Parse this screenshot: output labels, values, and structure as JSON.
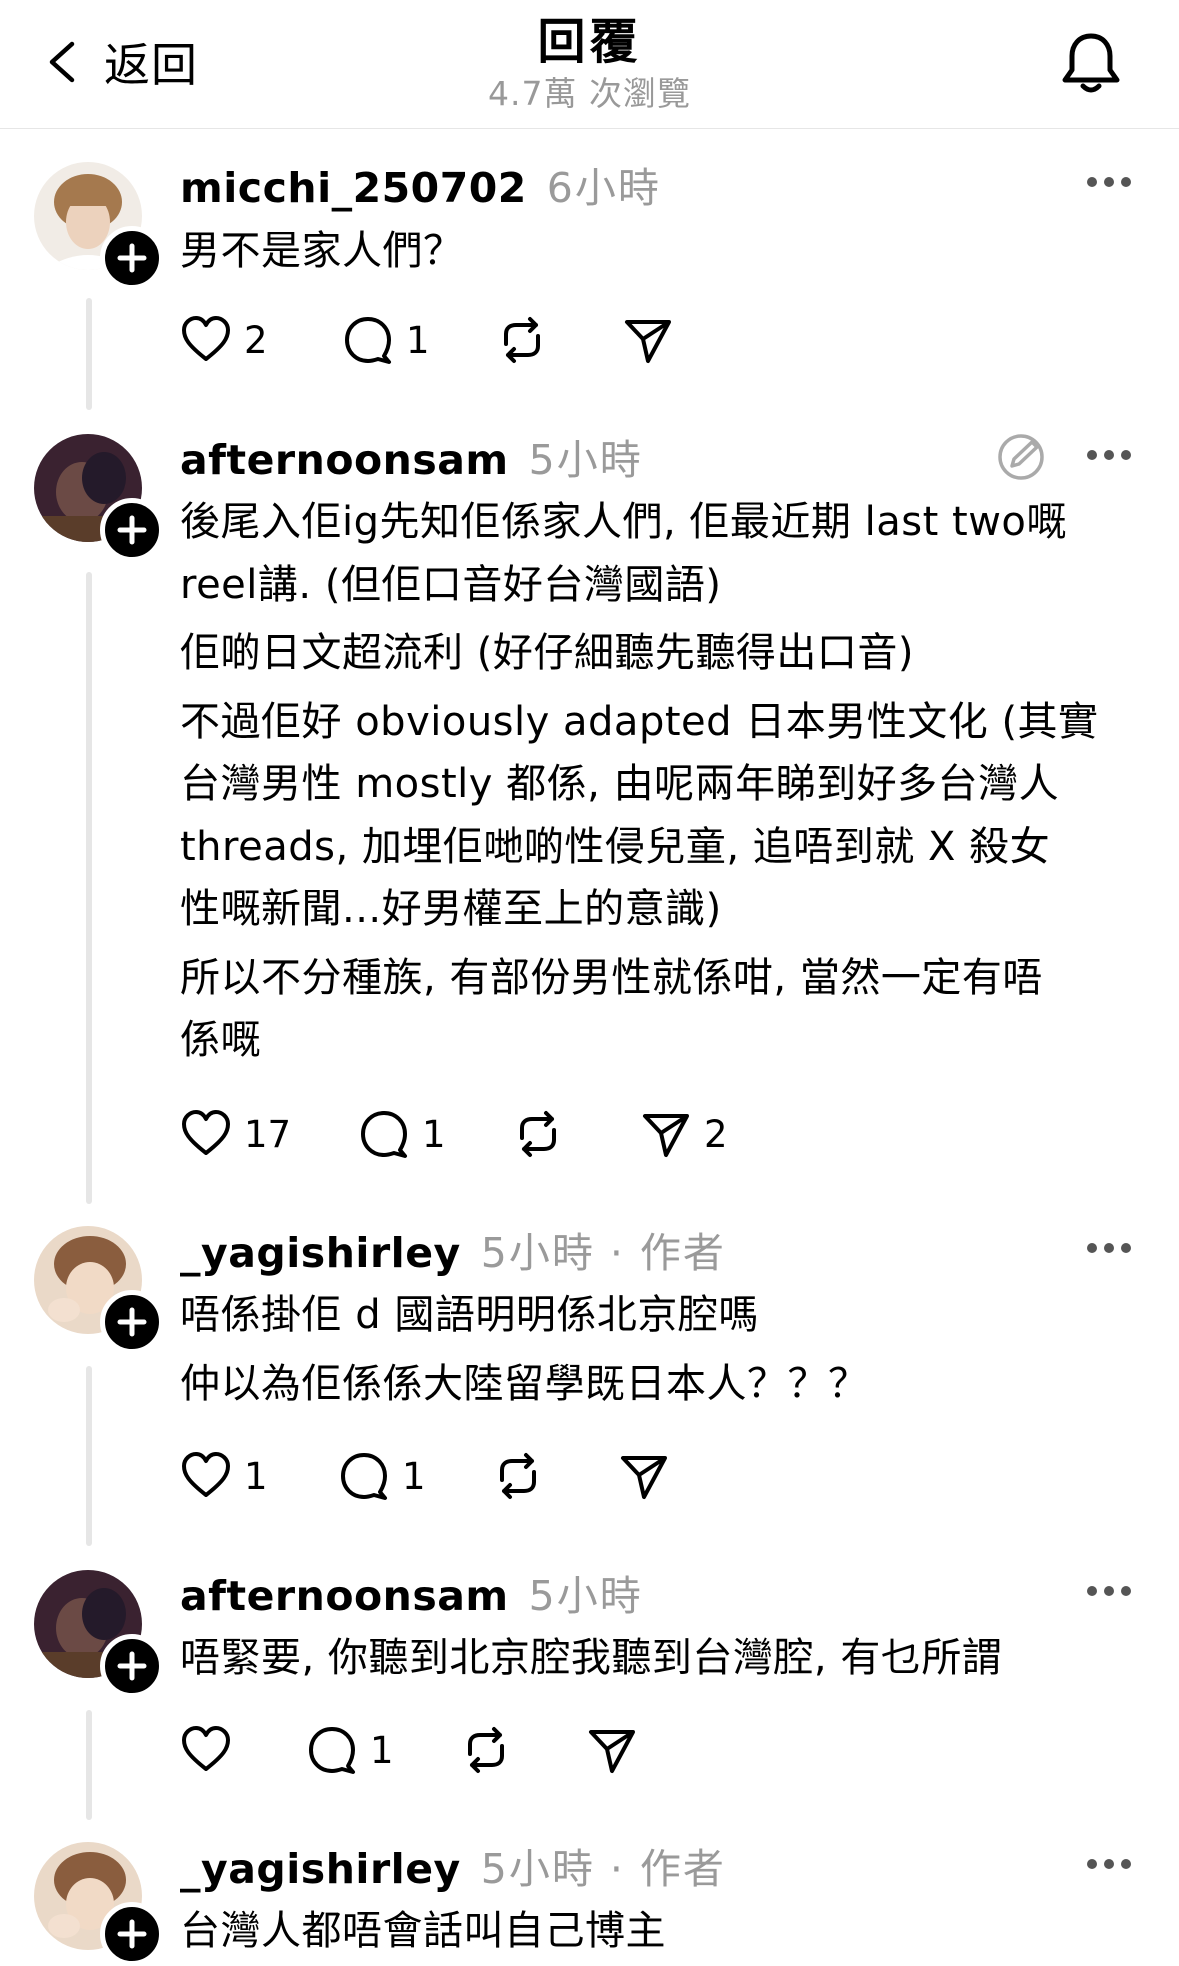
{
  "header": {
    "back_label": "返回",
    "title": "回覆",
    "views": "4.7萬 次瀏覽"
  },
  "icons": {
    "back": "chevron-left-icon",
    "bell": "bell-icon",
    "more": "more-dots-icon",
    "like": "heart-icon",
    "reply": "comment-icon",
    "repost": "repost-icon",
    "share": "send-icon",
    "edit": "edit-icon",
    "follow": "plus-icon"
  },
  "posts": [
    {
      "username": "micchi_250702",
      "time": "6小時",
      "lines": [
        "男不是家人們？"
      ],
      "likes": "2",
      "replies": "1",
      "reposts": "",
      "shares": ""
    },
    {
      "username": "afternoonsam",
      "time": "5小時",
      "lines": [
        "後尾入佢ig先知佢係家人們, 佢最近期 last two嘅",
        "reel講. (但佢口音好台灣國語)",
        "佢啲日文超流利 (好仔細聽先聽得出口音)",
        "不過佢好 obviously adapted 日本男性文化 (其實",
        "台灣男性 mostly 都係, 由呢兩年睇到好多台灣人",
        "threads, 加埋佢哋啲性侵兒童, 追唔到就 X 殺女",
        "性嘅新聞...好男權至上的意識)",
        "所以不分種族, 有部份男性就係咁, 當然一定有唔",
        "係嘅"
      ],
      "likes": "17",
      "replies": "1",
      "reposts": "",
      "shares": "2"
    },
    {
      "username": "_yagishirley",
      "time": "5小時 · 作者",
      "lines": [
        "唔係掛佢 d 國語明明係北京腔嗎",
        "仲以為佢係係大陸留學既日本人？？？"
      ],
      "likes": "1",
      "replies": "1",
      "reposts": "",
      "shares": ""
    },
    {
      "username": "afternoonsam",
      "time": "5小時",
      "lines": [
        "唔緊要, 你聽到北京腔我聽到台灣腔, 有乜所謂"
      ],
      "likes": "",
      "replies": "1",
      "reposts": "",
      "shares": ""
    },
    {
      "username": "_yagishirley",
      "time": "5小時 · 作者",
      "lines": [
        "台灣人都唔會話叫自己博主"
      ],
      "likes": "",
      "replies": "",
      "reposts": "",
      "shares": ""
    }
  ]
}
